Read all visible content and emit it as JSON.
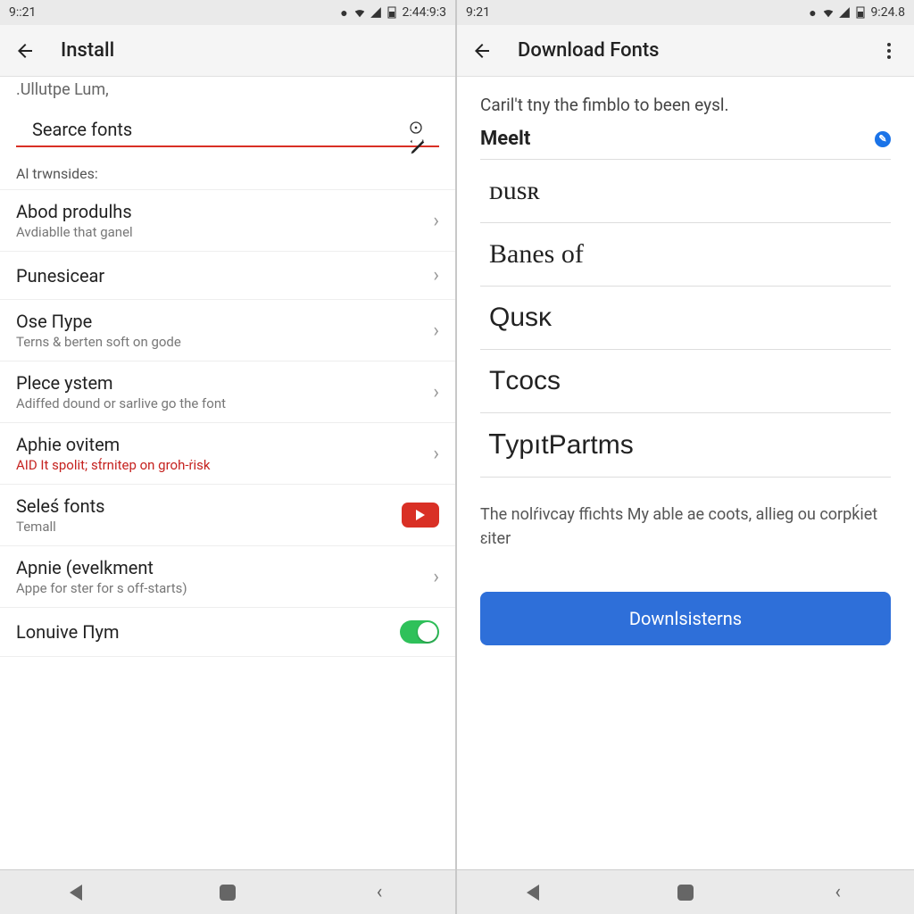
{
  "left": {
    "status": {
      "time": "9::21",
      "right_time": "2:44:9:3"
    },
    "title": "Install",
    "cutoff": ".Ullutpe Lum,",
    "search_label": "Searce fonts",
    "section": "Al trwnsides:",
    "items": [
      {
        "title": "Abod produlhs",
        "sub": "Avdiablle that ganel"
      },
      {
        "title": "Punesicear",
        "sub": ""
      },
      {
        "title": "Ose Пype",
        "sub": "Terns & berten soft on gode"
      },
      {
        "title": "Plece ystem",
        "sub": "Adiffed dound or sarlive go the font"
      },
      {
        "title": "Aphie ovitem",
        "sub": "AID It spolit; st́rnitep on groh-ṙisk",
        "subRed": true
      }
    ],
    "video_item": {
      "title": "Seleś fonts",
      "sub": "Temall"
    },
    "dev_item": {
      "title": "Apnie (evelkment",
      "sub": "Appe for ster for s off-starts)"
    },
    "toggle_item": {
      "title": "Lonuive Пym"
    }
  },
  "right": {
    "status": {
      "time": "9:21",
      "right_time": "9:24.8"
    },
    "title": "Download Fonts",
    "intro": "Caril't tny the fimblo to been eysl.",
    "preview": "Meelt",
    "fonts": [
      "ᴅusʀ",
      "Banes of",
      "Qusᴋ",
      "Tᴄocs",
      "ꓔypıtPartms"
    ],
    "footer": "The nolŕivcay ffichts My able ae coots, allieg ou corpḱiet ɛiter",
    "button": "Downlsisterns"
  }
}
